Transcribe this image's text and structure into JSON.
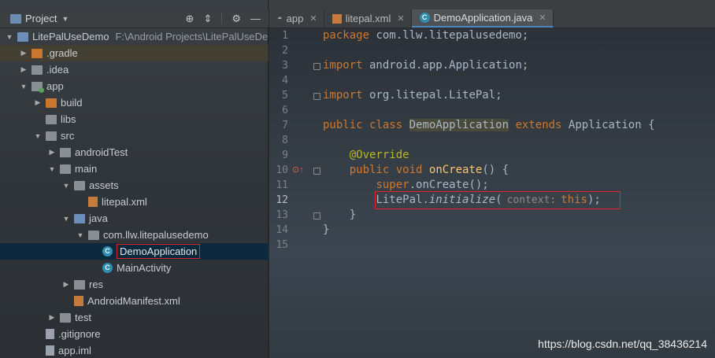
{
  "project_panel": {
    "title": "Project",
    "tree": [
      {
        "label": "LitePalUseDemo",
        "path": "F:\\Android Projects\\LitePalUseDe",
        "arrow": "▼",
        "icon": "folder-blue",
        "depth": 0
      },
      {
        "label": ".gradle",
        "arrow": "▶",
        "icon": "folder-orange",
        "depth": 1
      },
      {
        "label": ".idea",
        "arrow": "▶",
        "icon": "folder",
        "depth": 1
      },
      {
        "label": "app",
        "arrow": "▼",
        "icon": "folder-mod",
        "depth": 1
      },
      {
        "label": "build",
        "arrow": "▶",
        "icon": "folder-orange",
        "depth": 2
      },
      {
        "label": "libs",
        "arrow": "",
        "icon": "folder",
        "depth": 2
      },
      {
        "label": "src",
        "arrow": "▼",
        "icon": "folder",
        "depth": 2
      },
      {
        "label": "androidTest",
        "arrow": "▶",
        "icon": "folder",
        "depth": 3
      },
      {
        "label": "main",
        "arrow": "▼",
        "icon": "folder",
        "depth": 3
      },
      {
        "label": "assets",
        "arrow": "▼",
        "icon": "folder",
        "depth": 4
      },
      {
        "label": "litepal.xml",
        "arrow": "",
        "icon": "xml",
        "depth": 5
      },
      {
        "label": "java",
        "arrow": "▼",
        "icon": "folder-blue",
        "depth": 4
      },
      {
        "label": "com.llw.litepalusedemo",
        "arrow": "▼",
        "icon": "folder",
        "depth": 5
      },
      {
        "label": "DemoApplication",
        "arrow": "",
        "icon": "class-c",
        "depth": 6
      },
      {
        "label": "MainActivity",
        "arrow": "",
        "icon": "class-c",
        "depth": 6
      },
      {
        "label": "res",
        "arrow": "▶",
        "icon": "folder",
        "depth": 4
      },
      {
        "label": "AndroidManifest.xml",
        "arrow": "",
        "icon": "xml",
        "depth": 4
      },
      {
        "label": "test",
        "arrow": "▶",
        "icon": "folder",
        "depth": 3
      },
      {
        "label": ".gitignore",
        "arrow": "",
        "icon": "file",
        "depth": 2
      },
      {
        "label": "app.iml",
        "arrow": "",
        "icon": "file",
        "depth": 2
      }
    ]
  },
  "tabs": [
    {
      "label": "app",
      "icon": "android-icon"
    },
    {
      "label": "litepal.xml",
      "icon": "xml-file-icon"
    },
    {
      "label": "DemoApplication.java",
      "icon": "class-icon",
      "active": true
    }
  ],
  "class_icon_letter": "C",
  "editor": {
    "line_numbers": [
      "1",
      "2",
      "3",
      "4",
      "5",
      "6",
      "7",
      "8",
      "9",
      "10",
      "11",
      "12",
      "13",
      "14",
      "15"
    ],
    "inline_hint": "context:",
    "lines": {
      "l1": {
        "kw": "package",
        "rest": " com.llw.litepalusedemo;"
      },
      "l3": {
        "kw": "import",
        "rest": " android.app.Application;"
      },
      "l5": {
        "kw": "import",
        "rest": " org.litepal.LitePal;"
      },
      "l7": {
        "kw1": "public",
        "kw2": "class",
        "name": "DemoApplication",
        "kw3": "extends",
        "rest": " Application {"
      },
      "l9": {
        "annotation": "@Override"
      },
      "l10": {
        "kw1": "public",
        "kw2": "void",
        "name": "onCreate",
        "rest": "() {"
      },
      "l11": {
        "kw": "super",
        "rest": ".onCreate();"
      },
      "l12": {
        "obj": "LitePal.",
        "method": "initialize",
        "open": "(",
        "arg": "this",
        "close": ");"
      },
      "l13": {
        "text": "}"
      },
      "l14": {
        "text": "}"
      }
    }
  },
  "watermark": "https://blog.csdn.net/qq_38436214"
}
